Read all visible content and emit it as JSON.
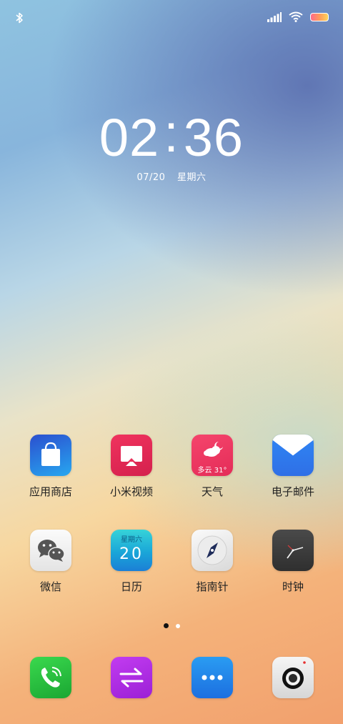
{
  "status": {
    "bluetooth_icon": "bluetooth-icon",
    "signal_icon": "signal-icon",
    "wifi_icon": "wifi-icon",
    "battery_icon": "battery-icon"
  },
  "lock": {
    "time_hours": "02",
    "time_minutes": "36",
    "date": "07/20",
    "weekday": "星期六"
  },
  "apps": [
    {
      "label": "应用商店",
      "icon": "shopping-bag-icon"
    },
    {
      "label": "小米视频",
      "icon": "tv-icon"
    },
    {
      "label": "天气",
      "icon": "weather-cloud-moon-icon",
      "badge": "多云 31°"
    },
    {
      "label": "电子邮件",
      "icon": "mail-envelope-icon"
    },
    {
      "label": "微信",
      "icon": "wechat-icon"
    },
    {
      "label": "日历",
      "icon": "calendar-icon",
      "weekday": "星期六",
      "day": "20"
    },
    {
      "label": "指南针",
      "icon": "compass-icon"
    },
    {
      "label": "时钟",
      "icon": "clock-icon"
    }
  ],
  "dock": [
    {
      "icon": "phone-icon"
    },
    {
      "icon": "transfer-arrows-icon"
    },
    {
      "icon": "messages-dots-icon"
    },
    {
      "icon": "camera-icon"
    }
  ],
  "colors": {
    "app_store": "#2c6ee0",
    "video": "#ea2e5a",
    "weather": "#f03a63",
    "mail": "#2f7df0",
    "calendar": "#1aa6d8",
    "phone": "#24c23c",
    "transfer": "#b02be0",
    "messages": "#1f86ea"
  },
  "pager": {
    "pages": 2,
    "active": 1
  }
}
